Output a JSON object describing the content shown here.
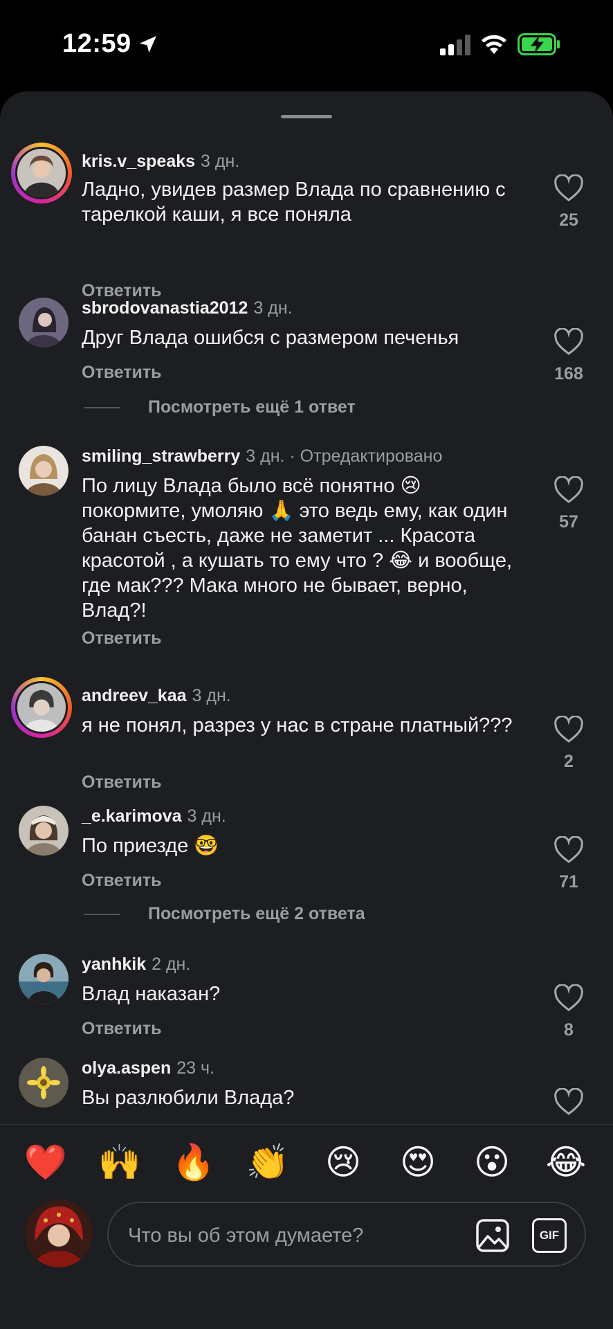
{
  "status_bar": {
    "time": "12:59"
  },
  "comments": [
    {
      "username": "kris.v_speaks",
      "meta": "3 дн.",
      "text": "Ладно, увидев размер Влада по сравнению с тарелкой каши, я все поняла",
      "reply": "Ответить",
      "likes": "25"
    },
    {
      "username": "sbrodovanastia2012",
      "meta": "3 дн.",
      "text": "Друг Влада ошибся с размером печенья",
      "reply": "Ответить",
      "likes": "168"
    },
    {
      "username": "smiling_strawberry",
      "meta": "3 дн. · Отредактировано",
      "text": "По лицу Влада было всё понятно 😢 покормите, умоляю 🙏 это ведь ему, как один банан съесть, даже не заметит ... Красота красотой , а кушать то ему что ? 😂 и вообще, где мак??? Мака много не бывает, верно, Влад?!",
      "reply": "Ответить",
      "likes": "57"
    },
    {
      "username": "andreev_kaa",
      "meta": "3 дн.",
      "text": "я не понял, разрез у нас в стране платный???",
      "reply": "Ответить",
      "likes": "2"
    },
    {
      "username": "_e.karimova",
      "meta": "3 дн.",
      "text": "По приезде 🤓",
      "reply": "Ответить",
      "likes": "71"
    },
    {
      "username": "yanhkik",
      "meta": "2 дн.",
      "text": "Влад наказан?",
      "reply": "Ответить",
      "likes": "8"
    },
    {
      "username": "olya.aspen",
      "meta": "23 ч.",
      "text": "Вы разлюбили Влада?",
      "reply": "",
      "likes": ""
    }
  ],
  "more_replies": [
    {
      "label": "Посмотреть ещё 1 ответ"
    },
    {
      "label": "Посмотреть ещё 2 ответа"
    }
  ],
  "emoji_bar": [
    "❤️",
    "🙌",
    "🔥",
    "👏",
    "😢",
    "😍",
    "😮",
    "😂"
  ],
  "composer": {
    "placeholder": "Что вы об этом думаете?",
    "gif_label": "GIF"
  },
  "icons": {
    "like": "heart-outline-icon",
    "image": "image-icon",
    "location": "location-arrow-icon"
  }
}
